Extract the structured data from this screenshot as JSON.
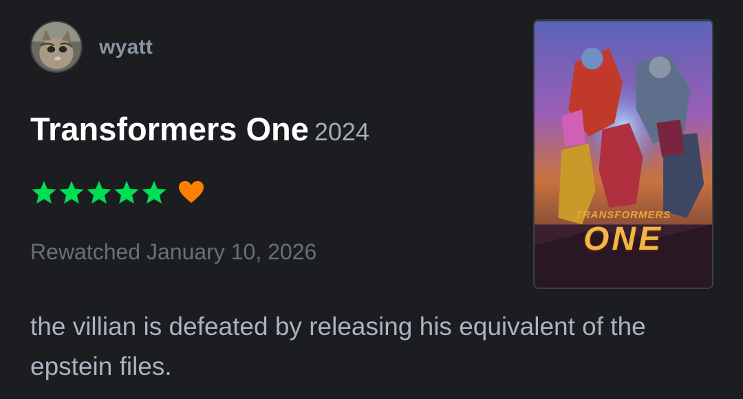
{
  "review": {
    "username": "wyatt",
    "film_title": "Transformers One",
    "film_year": "2024",
    "rating_stars": 5,
    "liked": true,
    "watched_label": "Rewatched January 10, 2026",
    "body": "the villian is defeated by releasing his equivalent of the epstein files."
  },
  "poster": {
    "title_small": "TRANSFORMERS",
    "title_big": "ONE"
  },
  "colors": {
    "background": "#1b1d21",
    "star": "#00e054",
    "heart": "#ff8000",
    "title": "#ffffff",
    "muted": "#67707b",
    "body_text": "#a9b4c0"
  },
  "icons": [
    "avatar-image",
    "star-icon",
    "heart-icon",
    "poster-image"
  ]
}
